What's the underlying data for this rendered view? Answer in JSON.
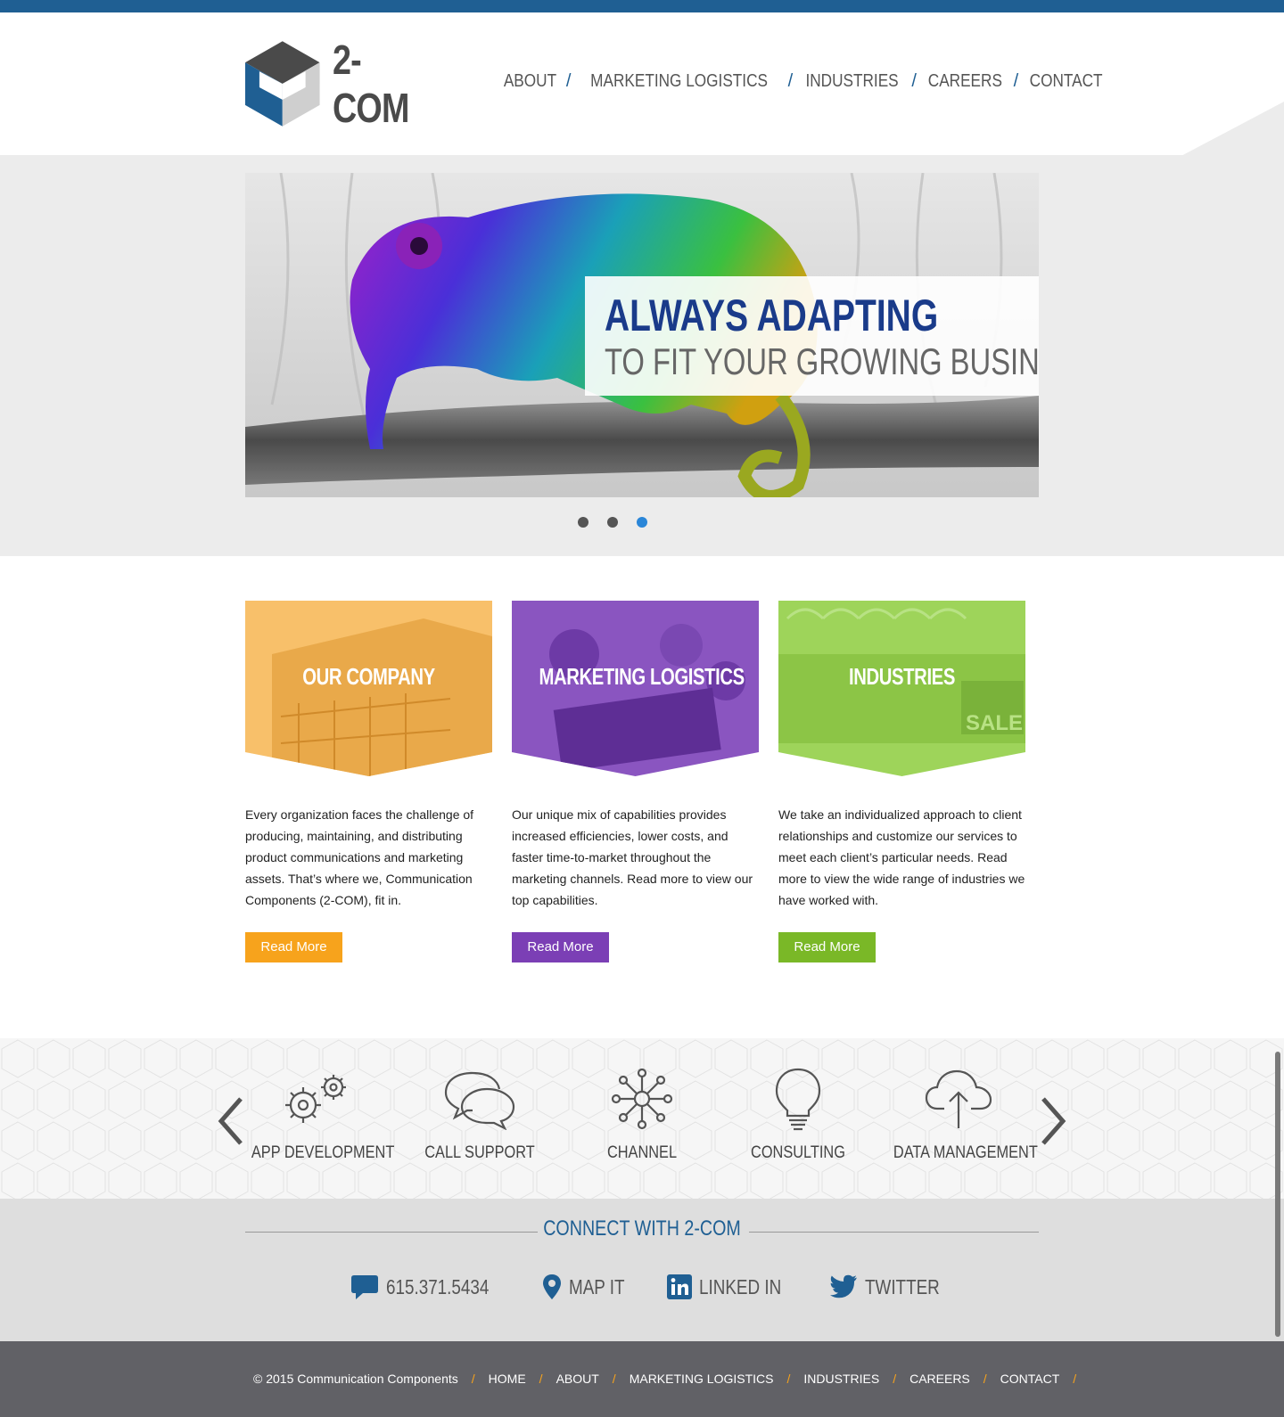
{
  "brand": {
    "name": "2-COM",
    "primary_color": "#1f5f93"
  },
  "nav": {
    "items": [
      "ABOUT",
      "MARKETING LOGISTICS",
      "INDUSTRIES",
      "CAREERS",
      "CONTACT"
    ],
    "separator": "/"
  },
  "hero": {
    "title": "ALWAYS ADAPTING",
    "subtitle": "TO FIT YOUR GROWING BUSINESS",
    "slides_total": 3,
    "active_slide": 3
  },
  "cards": [
    {
      "title": "OUR COMPANY",
      "text": "Every organization faces the challenge of producing, maintaining, and distributing product communications and marketing assets. That’s where we, Communication Components (2-COM), fit in.",
      "button": "Read More",
      "color": "#f7a31c"
    },
    {
      "title": "MARKETING LOGISTICS",
      "text": "Our unique mix of capabilities provides increased efficiencies, lower costs, and faster time-to-market throughout the marketing channels. Read more to view our top capabilities.",
      "button": "Read More",
      "color": "#7b3fb5"
    },
    {
      "title": "INDUSTRIES",
      "text": "We take an individualized approach to client relationships and customize our services to meet each client’s particular needs. Read more to view the wide range of industries we have worked with.",
      "button": "Read More",
      "color": "#7ab827"
    }
  ],
  "services": {
    "items": [
      {
        "label": "APP DEVELOPMENT",
        "icon": "gears-icon"
      },
      {
        "label": "CALL SUPPORT",
        "icon": "chat-bubbles-icon"
      },
      {
        "label": "CHANNEL",
        "icon": "network-hub-icon"
      },
      {
        "label": "CONSULTING",
        "icon": "lightbulb-icon"
      },
      {
        "label": "DATA MANAGEMENT",
        "icon": "cloud-upload-icon"
      }
    ]
  },
  "connect": {
    "title": "CONNECT WITH 2-COM",
    "items": [
      {
        "label": "615.371.5434",
        "icon": "chat-icon"
      },
      {
        "label": "MAP IT",
        "icon": "map-pin-icon"
      },
      {
        "label": "LINKED IN",
        "icon": "linkedin-icon"
      },
      {
        "label": "TWITTER",
        "icon": "twitter-icon"
      }
    ]
  },
  "footer": {
    "copyright": "© 2015 Communication Components",
    "links": [
      "HOME",
      "ABOUT",
      "MARKETING LOGISTICS",
      "INDUSTRIES",
      "CAREERS",
      "CONTACT"
    ],
    "separator": "/"
  }
}
